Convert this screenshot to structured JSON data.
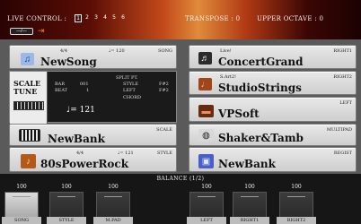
{
  "top": {
    "live_control_label": "LIVE CONTROL :",
    "live_control_pages": [
      "1",
      "2",
      "3",
      "4",
      "5",
      "6"
    ],
    "live_control_active": "1",
    "transpose": "TRANSPOSE : 0",
    "upper_octave": "UPPER OCTAVE : 0",
    "mini_button_label": "—/—"
  },
  "song": {
    "tag": "SONG",
    "time_sig": "4/4",
    "tempo": "♩= 120",
    "name": "NewSong"
  },
  "split": {
    "scale_tune_label": "SCALE TUNE",
    "bar_label": "BAR",
    "bar_value": "001",
    "beat_label": "BEAT",
    "beat_value": "1",
    "split_pt_label": "SPLIT PT.",
    "style_label": "STYLE",
    "style_value": "F#2",
    "left_label": "LEFT",
    "left_value": "F#2",
    "chord_label": "CHORD",
    "tempo": "♩= 121"
  },
  "scale": {
    "tag": "SCALE",
    "name": "NewBank"
  },
  "style": {
    "tag": "STYLE",
    "time_sig": "4/4",
    "tempo": "♩= 121",
    "name": "80sPowerRock"
  },
  "right1": {
    "tag": "RIGHT1",
    "sub": "Live!",
    "name": "ConcertGrand"
  },
  "right2": {
    "tag": "RIGHT2",
    "sub": "S.Art2!",
    "name": "StudioStrings"
  },
  "left": {
    "tag": "LEFT",
    "name": "VPSoft"
  },
  "multipad": {
    "tag": "MULTIPAD",
    "name": "Shaker&Tamb"
  },
  "regist": {
    "tag": "REGIST",
    "name": "NewBank"
  },
  "balance": {
    "title": "BALANCE (1/2)",
    "sliders": [
      {
        "value": "100",
        "label": "SONG"
      },
      {
        "value": "100",
        "label": "STYLE"
      },
      {
        "value": "100",
        "label": "M.PAD"
      },
      {
        "value": "100",
        "label": "LEFT"
      },
      {
        "value": "100",
        "label": "RIGHT1"
      },
      {
        "value": "100",
        "label": "RIGHT2"
      }
    ]
  },
  "colors": {
    "panel_bg": "#5a5a5a",
    "box_bg": "#dcdcdc",
    "accent_orange": "#ff7a1a"
  }
}
